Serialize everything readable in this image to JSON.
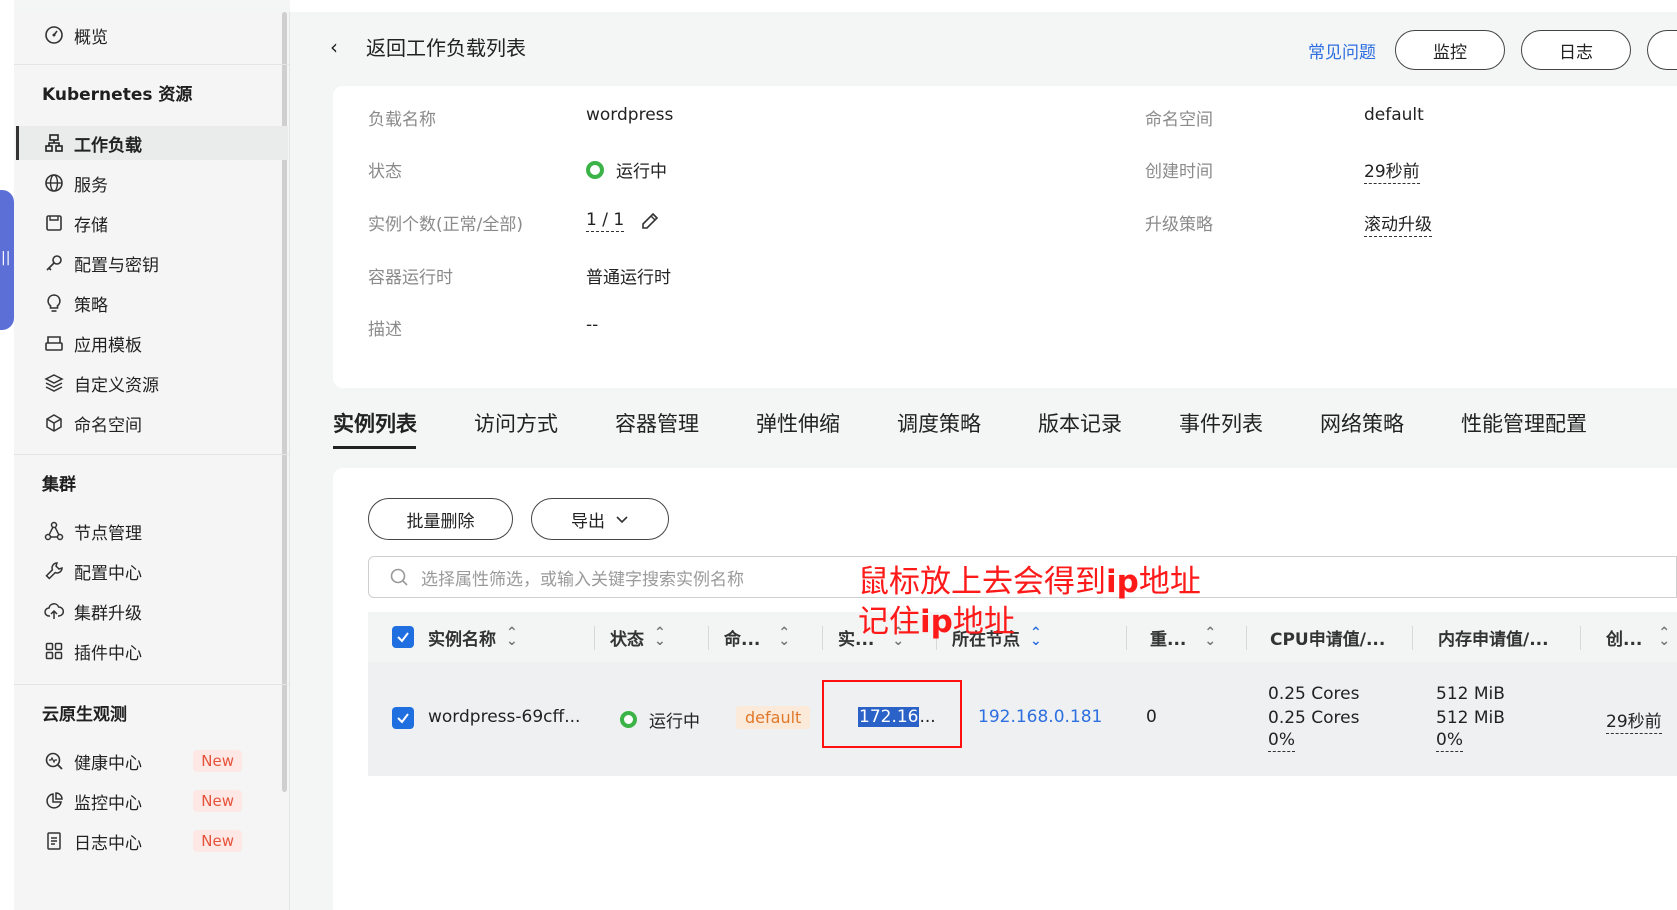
{
  "sidebar": {
    "overview": "概览",
    "k8s_group": "Kubernetes 资源",
    "k8s_items": [
      "工作负载",
      "服务",
      "存储",
      "配置与密钥",
      "策略",
      "应用模板",
      "自定义资源",
      "命名空间"
    ],
    "cluster_group": "集群",
    "cluster_items": [
      "节点管理",
      "配置中心",
      "集群升级",
      "插件中心"
    ],
    "observe_group": "云原生观测",
    "observe_items": [
      "健康中心",
      "监控中心",
      "日志中心"
    ],
    "new_badge": "New"
  },
  "header": {
    "back_label": "返回工作负载列表",
    "faq_label": "常见问题",
    "monitor_label": "监控",
    "log_label": "日志"
  },
  "info": {
    "name_label": "负载名称",
    "name_value": "wordpress",
    "ns_label": "命名空间",
    "ns_value": "default",
    "status_label": "状态",
    "status_value": "运行中",
    "created_label": "创建时间",
    "created_value": "29秒前",
    "replicas_label": "实例个数(正常/全部)",
    "replicas_value": "1 / 1",
    "upgrade_label": "升级策略",
    "upgrade_value": "滚动升级",
    "runtime_label": "容器运行时",
    "runtime_value": "普通运行时",
    "desc_label": "描述",
    "desc_value": "--"
  },
  "tabs": [
    "实例列表",
    "访问方式",
    "容器管理",
    "弹性伸缩",
    "调度策略",
    "版本记录",
    "事件列表",
    "网络策略",
    "性能管理配置"
  ],
  "toolbar": {
    "batch_delete": "批量删除",
    "export": "导出",
    "search_placeholder": "选择属性筛选，或输入关键字搜索实例名称"
  },
  "table": {
    "headers": [
      "实例名称",
      "状态",
      "命...",
      "实...",
      "所在节点",
      "重...",
      "CPU申请值/...",
      "内存申请值/...",
      "创..."
    ],
    "row": {
      "name": "wordpress-69cff...",
      "status": "运行中",
      "namespace": "default",
      "ip_highlight": "172.16",
      "ip_rest": "...",
      "node": "192.168.0.181",
      "restarts": "0",
      "cpu_req": "0.25 Cores",
      "cpu_limit": "0.25 Cores",
      "cpu_pct": "0%",
      "mem_req": "512 MiB",
      "mem_limit": "512 MiB",
      "mem_pct": "0%",
      "created": "29秒前"
    }
  },
  "annotation": {
    "line1_a": "鼠标放上去会得到",
    "line1_b": "ip",
    "line1_c": "地址",
    "line2_a": "记住",
    "line2_b": "ip",
    "line2_c": "地址"
  },
  "colors": {
    "accent": "#2d6fe0",
    "running": "#3bb346",
    "annotation": "#ff1a1a",
    "namespace_tag": "#e0782a",
    "new_badge": "#e6533c"
  }
}
